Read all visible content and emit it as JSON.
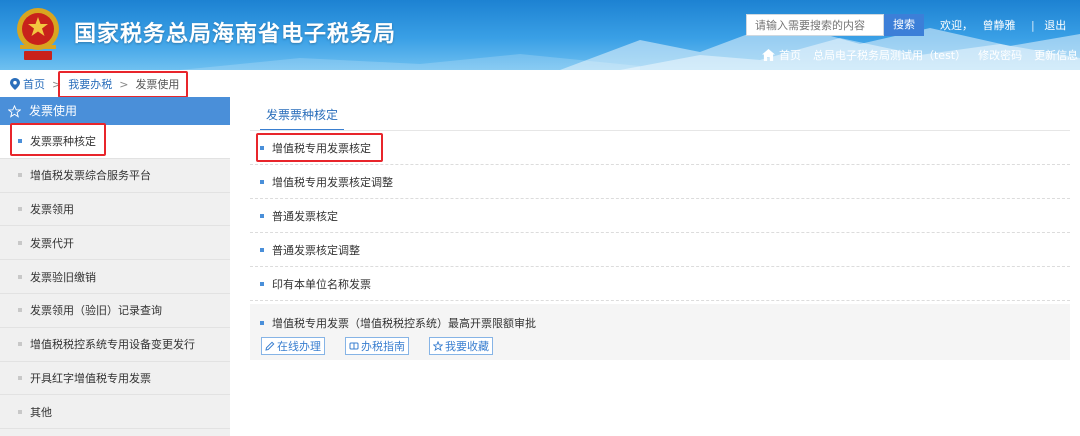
{
  "header": {
    "site_title": "国家税务总局海南省电子税务局",
    "search_placeholder": "请输入需要搜索的内容",
    "search_button": "搜索",
    "welcome": "欢迎，",
    "user_name": "曾静雅",
    "separator": "|",
    "logout": "退出",
    "subnav": {
      "home": "首页",
      "org": "总局电子税务局测试用（test）",
      "change_password": "修改密码",
      "update_info": "更新信息"
    },
    "colors": {
      "accent": "#1d82d2",
      "highlight": "#e8252b"
    }
  },
  "breadcrumb": {
    "home": "首页",
    "sep": ">",
    "level1": "我要办税",
    "level2": "发票使用"
  },
  "sidebar": {
    "header": "发票使用",
    "items": [
      {
        "label": "发票票种核定"
      },
      {
        "label": "增值税发票综合服务平台"
      },
      {
        "label": "发票领用"
      },
      {
        "label": "发票代开"
      },
      {
        "label": "发票验旧缴销"
      },
      {
        "label": "发票领用（验旧）记录查询"
      },
      {
        "label": "增值税税控系统专用设备变更发行"
      },
      {
        "label": "开具红字增值税专用发票"
      },
      {
        "label": "其他"
      }
    ]
  },
  "main": {
    "tab": "发票票种核定",
    "items": [
      {
        "label": "增值税专用发票核定"
      },
      {
        "label": "增值税专用发票核定调整"
      },
      {
        "label": "普通发票核定"
      },
      {
        "label": "普通发票核定调整"
      },
      {
        "label": "印有本单位名称发票"
      }
    ],
    "expanded": {
      "label": "增值税专用发票（增值税税控系统）最高开票限额审批",
      "actions": {
        "online": "在线办理",
        "guide": "办税指南",
        "favorite": "我要收藏"
      }
    }
  }
}
